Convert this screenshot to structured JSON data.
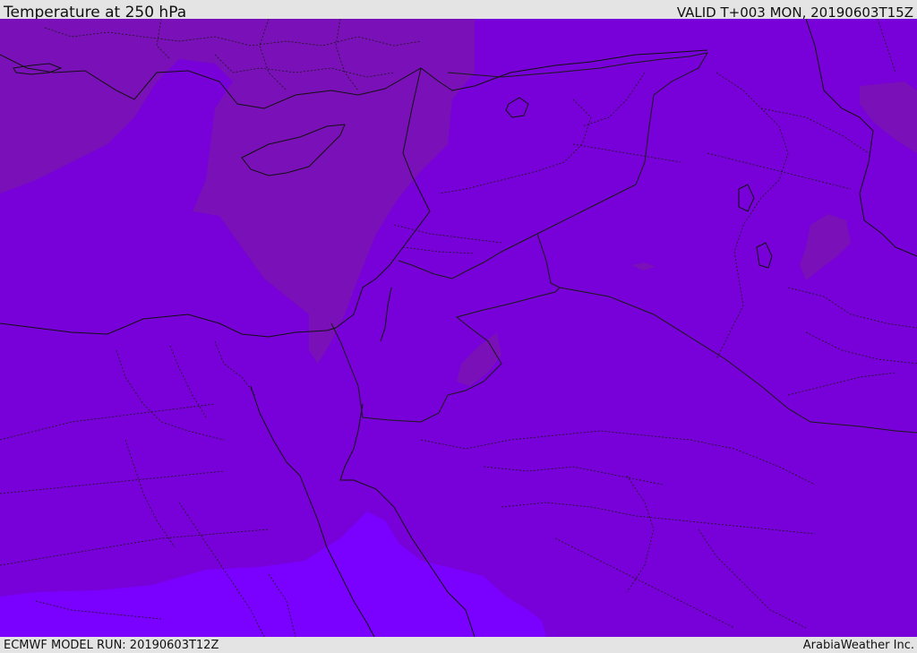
{
  "header": {
    "title": "Temperature at 250 hPa",
    "valid_time": "VALID T+003 MON, 20190603T15Z"
  },
  "footer": {
    "model_run": "ECMWF MODEL RUN: 20190603T12Z",
    "credit": "ArabiaWeather Inc."
  },
  "map": {
    "colors": {
      "base": "#7800d8",
      "warm_zone": "#7a10b8",
      "cold_zone": "#7a00ff",
      "land_outline": "#111111",
      "country_border": "#1a1a1a",
      "header_bg": "#e4e4e4"
    }
  }
}
